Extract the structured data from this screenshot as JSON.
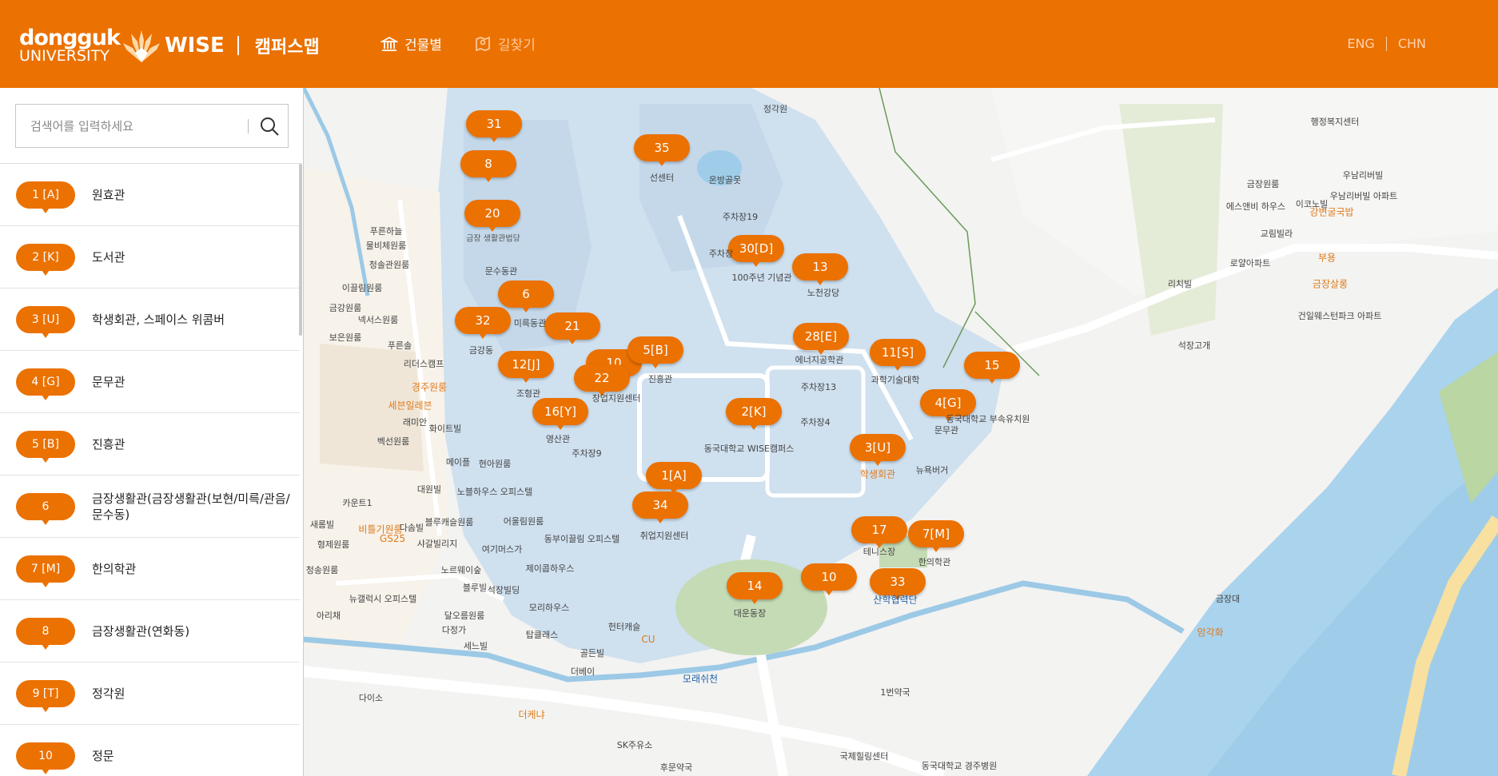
{
  "header": {
    "logo_top": "dongguk",
    "logo_bottom": "UNIVERSITY",
    "logo_wise": "WISE",
    "title": "캠퍼스맵",
    "nav": [
      {
        "label": "건물별",
        "icon": "building-icon"
      },
      {
        "label": "길찾기",
        "icon": "map-pin-icon"
      }
    ],
    "lang": [
      "ENG",
      "CHN"
    ]
  },
  "search": {
    "placeholder": "검색어를 입력하세요",
    "value": ""
  },
  "buildings": [
    {
      "code": "1 [A]",
      "name": "원효관"
    },
    {
      "code": "2 [K]",
      "name": "도서관"
    },
    {
      "code": "3 [U]",
      "name": "학생회관, 스페이스 위콤버"
    },
    {
      "code": "4 [G]",
      "name": "문무관"
    },
    {
      "code": "5 [B]",
      "name": "진흥관"
    },
    {
      "code": "6",
      "name": "금장생활관(금장생활관(보현/미륵/관음/문수동)"
    },
    {
      "code": "7 [M]",
      "name": "한의학관"
    },
    {
      "code": "8",
      "name": "금장생활관(연화동)"
    },
    {
      "code": "9 [T]",
      "name": "정각원"
    },
    {
      "code": "10",
      "name": "정문"
    }
  ],
  "map": {
    "markers": [
      "31",
      "35",
      "8",
      "20",
      "6",
      "32",
      "21",
      "30[D]",
      "13",
      "12[J]",
      "10",
      "22",
      "5[B]",
      "16[Y]",
      "2[K]",
      "28[E]",
      "11[S]",
      "15",
      "4[G]",
      "3[U]",
      "1[A]",
      "34",
      "17",
      "7[M]",
      "14",
      "10",
      "33"
    ],
    "labels": [
      "정각원",
      "선센터",
      "온방골못",
      "주차장19",
      "주차장",
      "100주년 기념관",
      "노천강당",
      "금장 생활관법당",
      "문수동관",
      "미륵동관",
      "금강동",
      "조형관",
      "창업지원센터",
      "진흥관",
      "에너지공학관",
      "주차장13",
      "주차장4",
      "과학기술대학",
      "문무관",
      "동국대학교 부속유치원",
      "동국대학교 WISE캠퍼스",
      "학생회관",
      "뉴욕버거",
      "취업지원센터",
      "테니스장",
      "한의학관",
      "산학협력단",
      "대운동장",
      "영산관",
      "주차장9",
      "1번약국",
      "후문약국",
      "SK주유소",
      "더케냐",
      "다이소",
      "국제힐링센터",
      "동국대학교 경주병원",
      "석장고개",
      "암각화",
      "강변굴국밥",
      "부용",
      "금장살롱",
      "우남리버빌 아파트",
      "우남리버빌",
      "에스앤비 하우스",
      "이코노빌",
      "금장원룸",
      "교림빌라",
      "로얄아파트",
      "리치빌",
      "건일웨스턴파크 아파트",
      "행정복지센터",
      "금장대",
      "푸른하늘",
      "물비체원룸",
      "청솔관원룸",
      "이끌림원룸",
      "금강원룸",
      "넥서스원룸",
      "보은원룸",
      "푸른솔",
      "리더스캠프",
      "경주원룸",
      "세븐일레븐",
      "래미안",
      "화이트빌",
      "벡선원룸",
      "메이플",
      "현아원룸",
      "노블하우스 오피스텔",
      "대원빌",
      "카운트1",
      "비틀기원룸",
      "GS25",
      "다솜빌",
      "블루캐슬원룸",
      "어울림원룸",
      "동부이끌림 오피스텔",
      "새롬빌",
      "형제원룸",
      "샤갈빌리지",
      "여기머스가",
      "청송원룸",
      "노르웨이숲",
      "제이콥하우스",
      "뉴갤럭시 오피스텔",
      "블루빌",
      "석장빌딩",
      "달오름원룸",
      "모리하우스",
      "다정가",
      "세느빌",
      "탑클래스",
      "헌터캐슬",
      "골든빌",
      "더베이",
      "CU",
      "모래쉬천",
      "아리채"
    ]
  }
}
